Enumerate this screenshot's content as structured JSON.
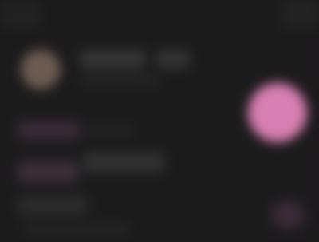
{
  "colors": {
    "background": "#1c1b1c",
    "accent": "#d77fb2",
    "avatar": "#6d5b52",
    "muted_row": "#3a2b37"
  },
  "icons": {
    "primary_action": "circle-action-icon",
    "secondary_action": "circle-secondary-icon",
    "avatar": "profile-avatar-icon"
  }
}
